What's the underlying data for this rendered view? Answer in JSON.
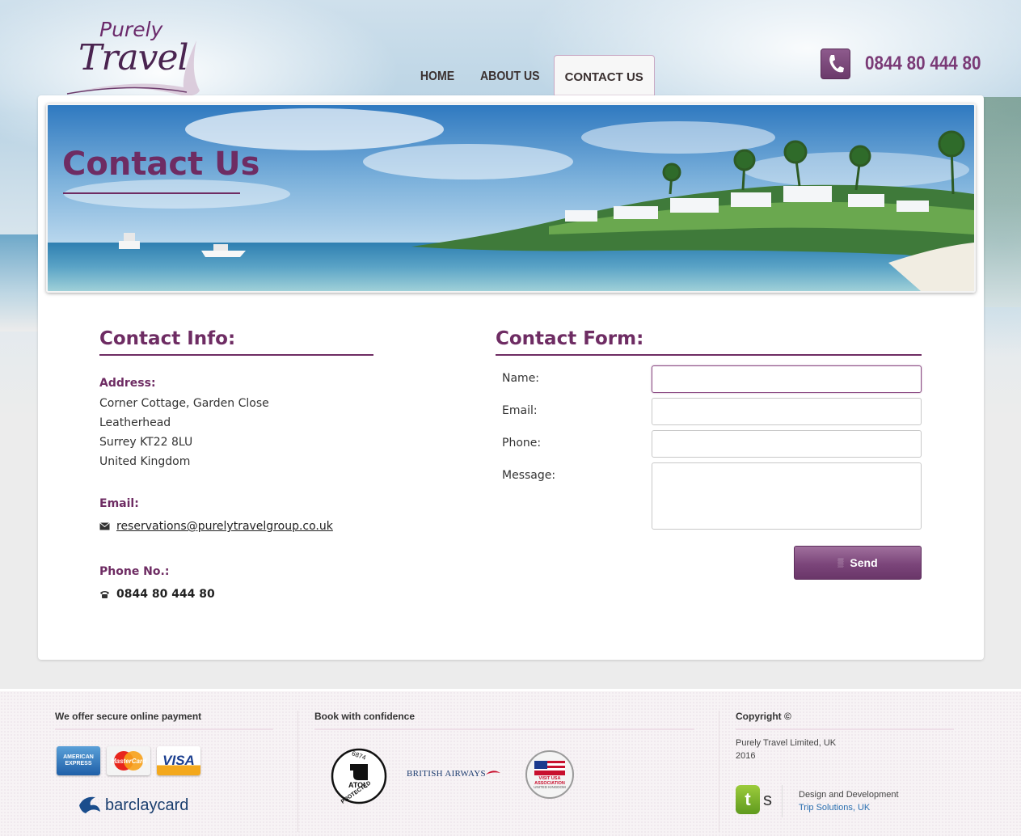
{
  "header": {
    "logo_top": "Purely",
    "logo_bottom": "Travel",
    "nav": [
      {
        "label": "HOME",
        "active": false
      },
      {
        "label": "ABOUT US",
        "active": false
      },
      {
        "label": "CONTACT US",
        "active": true
      }
    ],
    "phone": "0844 80 444 80",
    "phone_icon": "phone-icon"
  },
  "banner": {
    "title": "Contact Us"
  },
  "contact_info": {
    "title": "Contact Info:",
    "address_label": "Address:",
    "address_lines": [
      "Corner Cottage, Garden Close",
      "Leatherhead",
      "Surrey KT22 8LU",
      "United Kingdom"
    ],
    "email_label": "Email:",
    "email": "reservations@purelytravelgroup.co.uk",
    "phone_label": "Phone No.:",
    "phone": "0844 80 444 80"
  },
  "contact_form": {
    "title": "Contact Form:",
    "fields": {
      "name_label": "Name:",
      "name_value": "",
      "email_label": "Email:",
      "email_value": "",
      "phone_label": "Phone:",
      "phone_value": "",
      "message_label": "Message:",
      "message_value": ""
    },
    "send_label": "Send"
  },
  "footer": {
    "payment_title": "We offer secure online payment",
    "cards": [
      "AMERICAN EXPRESS",
      "MasterCard",
      "VISA"
    ],
    "barclaycard": "barclaycard",
    "confidence_title": "Book with confidence",
    "atol_number": "6874",
    "atol_label": "ATOL",
    "atol_sub": "PROTECTED",
    "airline": "BRITISH AIRWAYS",
    "visit_usa": "VISIT USA ASSOCIATION",
    "visit_usa_sub": "UNITED KINGDOM",
    "copyright_title": "Copyright ©",
    "company": "Purely Travel Limited, UK",
    "year": "2016",
    "design_label": "Design and Development",
    "design_link": "Trip Solutions, UK",
    "ts_logo": "ts"
  },
  "colors": {
    "brand_purple": "#6e2c63",
    "link_blue": "#2a6fb0"
  }
}
